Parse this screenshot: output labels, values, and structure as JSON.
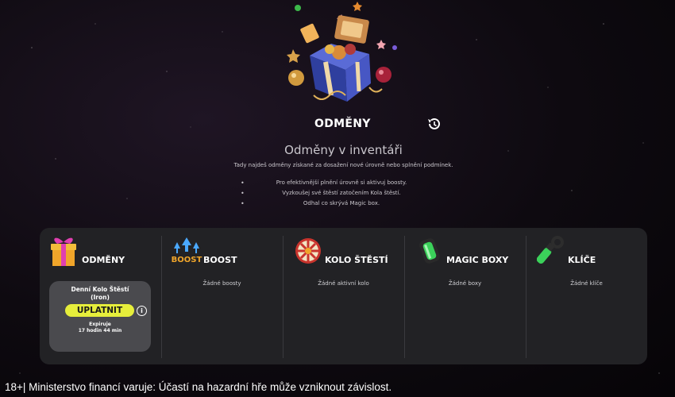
{
  "header": {
    "title": "ODMĚNY",
    "history_icon": "history-icon"
  },
  "inventory": {
    "subtitle": "Odměny v inventáři",
    "description": "Tady najdeš odměny získané za dosažení nové úrovně nebo splnění podmínek.",
    "tips": [
      "Pro efektivnější plnění úrovně si aktivuj boosty.",
      "Vyzkoušej své štěstí zatočením Kola štěstí.",
      "Odhal co skrývá Magic box."
    ]
  },
  "categories": [
    {
      "label": "ODMĚNY",
      "icon": "gift-icon"
    },
    {
      "label": "BOOST",
      "icon": "boost-icon",
      "icon_text": "BOOST",
      "empty": "Žádné boosty"
    },
    {
      "label": "KOLO ŠTĚSTÍ",
      "icon": "wheel-icon",
      "empty": "Žádné aktivní kolo"
    },
    {
      "label": "MAGIC BOXY",
      "icon": "magic-box-icon",
      "empty": "Žádné boxy"
    },
    {
      "label": "KLÍČE",
      "icon": "key-icon",
      "empty": "Žádné klíče"
    }
  ],
  "reward_card": {
    "title_line1": "Denní Kolo Štěstí",
    "title_line2": "(Iron)",
    "button": "UPLATNIT",
    "expires_label": "Expiruje",
    "expires_value": "17 hodin 44 min"
  },
  "footer": {
    "disclaimer": "18+| Ministerstvo financí varuje: Účastí na hazardní hře může vzniknout závislost."
  },
  "colors": {
    "panel": "#222225",
    "card": "#4a4a4e",
    "button": "#e6ee3b"
  }
}
